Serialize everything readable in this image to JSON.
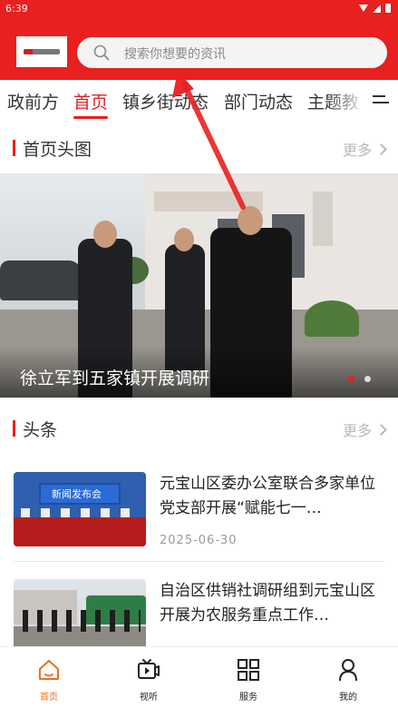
{
  "status_bar": {
    "time": "6:39"
  },
  "search": {
    "placeholder": "搜索你想要的资讯"
  },
  "tabs": [
    {
      "label": "政前方"
    },
    {
      "label": "首页"
    },
    {
      "label": "镇乡街动态"
    },
    {
      "label": "部门动态"
    },
    {
      "label": "主题教"
    }
  ],
  "headline_section": {
    "title": "首页头图",
    "more": "更多"
  },
  "banner": {
    "caption": "徐立军到五家镇开展调研",
    "slide_count": 2,
    "active_slide": 1
  },
  "news_section": {
    "title": "头条",
    "more": "更多"
  },
  "news": [
    {
      "title": "元宝山区委办公室联合多家单位党支部开展“赋能七一…",
      "date": "2025-06-30",
      "thumb_text": "新闻发布会"
    },
    {
      "title": "自治区供销社调研组到元宝山区开展为农服务重点工作…",
      "date": ""
    }
  ],
  "bottom_nav": [
    {
      "label": "首页",
      "icon": "home-icon",
      "active": true
    },
    {
      "label": "视听",
      "icon": "video-icon",
      "active": false
    },
    {
      "label": "服务",
      "icon": "grid-icon",
      "active": false
    },
    {
      "label": "我的",
      "icon": "user-icon",
      "active": false
    }
  ],
  "colors": {
    "brand_red": "#e8201f",
    "active_nav": "#e8701f",
    "muted_text": "#999999"
  }
}
